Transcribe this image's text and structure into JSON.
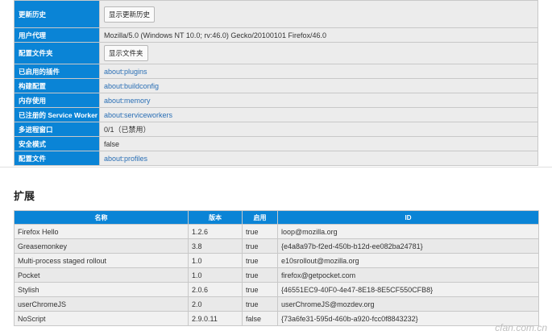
{
  "app_info": {
    "rows": [
      {
        "label": "更新历史",
        "button": "显示更新历史"
      },
      {
        "label": "用户代理",
        "value": "Mozilla/5.0 (Windows NT 10.0; rv:46.0) Gecko/20100101 Firefox/46.0"
      },
      {
        "label": "配置文件夹",
        "button": "显示文件夹"
      },
      {
        "label": "已启用的插件",
        "link": "about:plugins"
      },
      {
        "label": "构建配置",
        "link": "about:buildconfig"
      },
      {
        "label": "内存使用",
        "link": "about:memory"
      },
      {
        "label": "已注册的 Service Worker",
        "link": "about:serviceworkers"
      },
      {
        "label": "多进程窗口",
        "value": "0/1（已禁用）"
      },
      {
        "label": "安全模式",
        "value": "false"
      },
      {
        "label": "配置文件",
        "link": "about:profiles"
      }
    ]
  },
  "extensions": {
    "title": "扩展",
    "columns": [
      "名称",
      "版本",
      "启用",
      "ID"
    ],
    "rows": [
      [
        "Firefox Hello",
        "1.2.6",
        "true",
        "loop@mozilla.org"
      ],
      [
        "Greasemonkey",
        "3.8",
        "true",
        "{e4a8a97b-f2ed-450b-b12d-ee082ba24781}"
      ],
      [
        "Multi-process staged rollout",
        "1.0",
        "true",
        "e10srollout@mozilla.org"
      ],
      [
        "Pocket",
        "1.0",
        "true",
        "firefox@getpocket.com"
      ],
      [
        "Stylish",
        "2.0.6",
        "true",
        "{46551EC9-40F0-4e47-8E18-8E5CF550CFB8}"
      ],
      [
        "userChromeJS",
        "2.0",
        "true",
        "userChromeJS@mozdev.org"
      ],
      [
        "NoScript",
        "2.9.0.11",
        "false",
        "{73a6fe31-595d-460b-a920-fcc0f8843232}"
      ]
    ]
  },
  "watermark": "cfan.com.cn"
}
